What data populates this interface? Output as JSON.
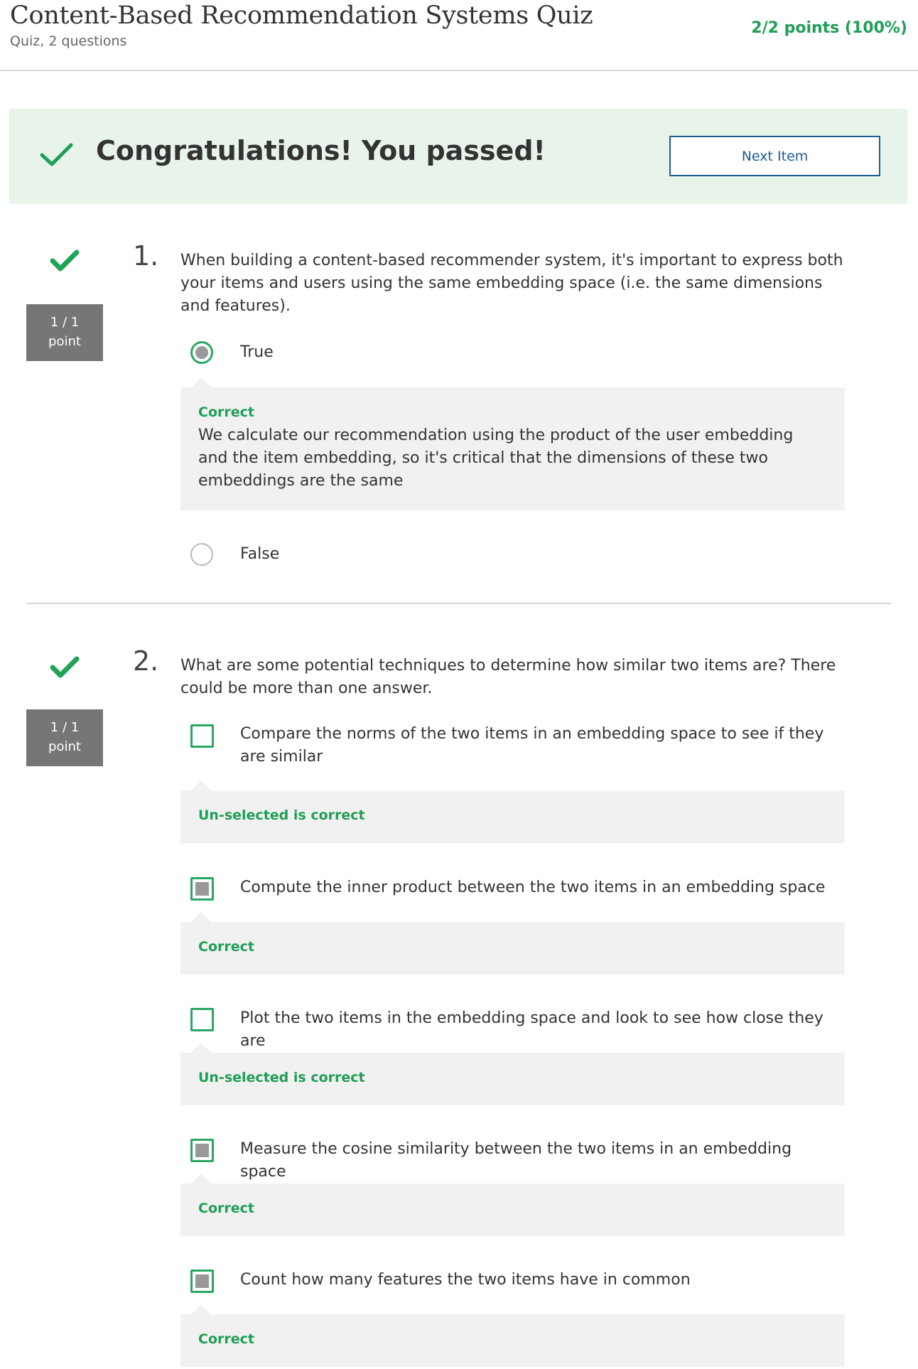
{
  "header": {
    "title": "Content-Based Recommendation Systems Quiz",
    "subtitle": "Quiz, 2 questions",
    "score": "2/2 points (100%)"
  },
  "banner": {
    "message": "Congratulations! You passed!",
    "next_label": "Next Item"
  },
  "colors": {
    "success_green": "#1f9e57",
    "button_blue": "#1f5b93",
    "banner_bg": "#e8f4ea",
    "badge_gray": "#767676",
    "feedback_bg": "#f1f1f1"
  },
  "questions": [
    {
      "number": "1.",
      "points": "1 / 1",
      "points_unit": "point",
      "status_icon": "checkmark-icon",
      "prompt": "When building a content-based recommender system, it's important to express both your items and users using the same embedding space (i.e. the same dimensions and features).",
      "type": "radio",
      "options": [
        {
          "label": "True",
          "selected": true,
          "feedback_status": "Correct",
          "feedback_text": "We calculate our recommendation using the product of the user embedding and the item embedding, so it's critical that the dimensions of these two embeddings are the same"
        },
        {
          "label": "False",
          "selected": false
        }
      ]
    },
    {
      "number": "2.",
      "points": "1 / 1",
      "points_unit": "point",
      "status_icon": "checkmark-icon",
      "prompt": "What are some potential techniques to determine how similar two items are? There could be more than one answer.",
      "type": "checkbox",
      "options": [
        {
          "label": "Compare the norms of the two items in an embedding space to see if they are similar",
          "selected": false,
          "feedback_status": "Un-selected is correct"
        },
        {
          "label": "Compute the inner product between the two items in an embedding space",
          "selected": true,
          "feedback_status": "Correct"
        },
        {
          "label": "Plot the two items in the embedding space and look to see how close they are",
          "selected": false,
          "feedback_status": "Un-selected is correct"
        },
        {
          "label": "Measure the cosine similarity between the two items in an embedding space",
          "selected": true,
          "feedback_status": "Correct"
        },
        {
          "label": "Count how many features the two items have in common",
          "selected": true,
          "feedback_status": "Correct"
        }
      ]
    }
  ]
}
